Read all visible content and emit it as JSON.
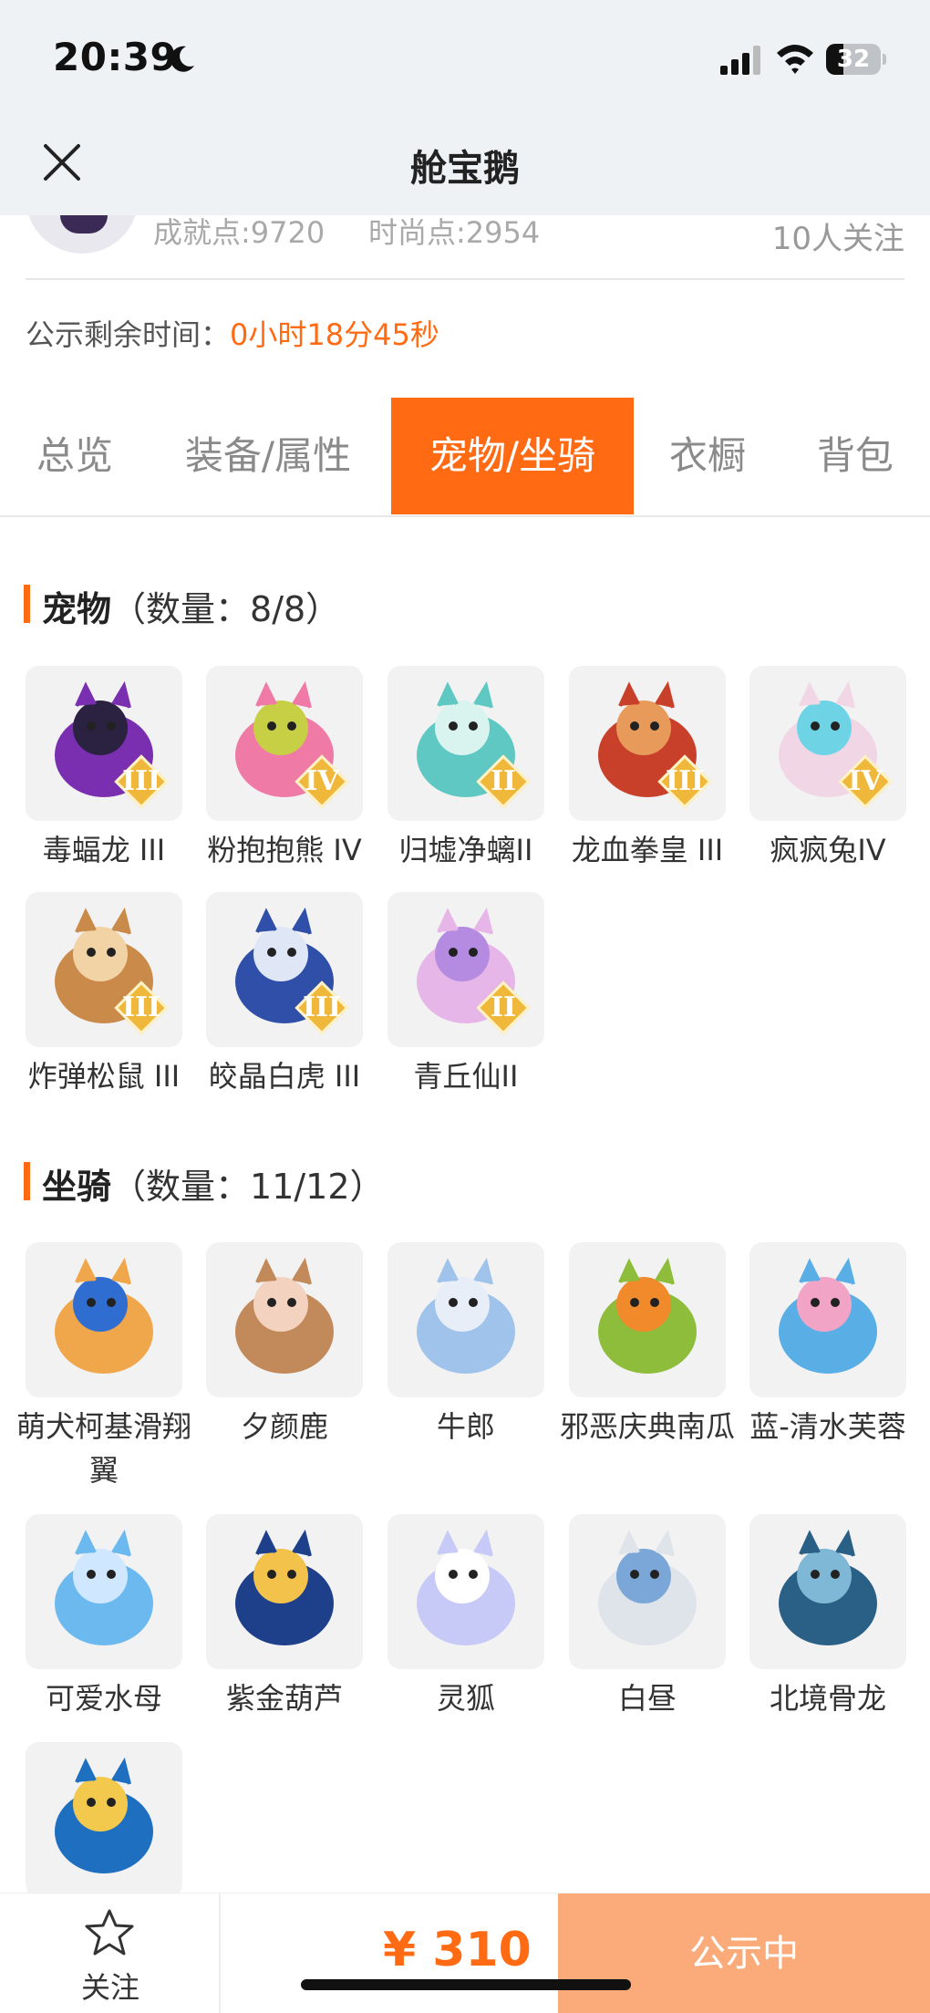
{
  "status_bar": {
    "time": "20:39",
    "battery": "32"
  },
  "header": {
    "title": "舱宝鹅"
  },
  "profile": {
    "achievement_points": "成就点:9720",
    "fashion_points": "时尚点:2954",
    "followers": "10人关注"
  },
  "notice": {
    "label": "公示剩余时间：",
    "value": "0小时18分45秒"
  },
  "tabs": [
    {
      "label": "总览"
    },
    {
      "label": "装备/属性"
    },
    {
      "label": "宠物/坐骑"
    },
    {
      "label": "衣橱"
    },
    {
      "label": "背包"
    }
  ],
  "active_tab": "宠物/坐骑",
  "pets": {
    "title": "宠物",
    "count": "（数量：8/8）",
    "items": [
      {
        "name": "毒蝠龙 III",
        "grade": "III",
        "icon": "dragon-bat-icon"
      },
      {
        "name": "粉抱抱熊 IV",
        "grade": "IV",
        "icon": "pink-bear-icon"
      },
      {
        "name": "归墟净螭II",
        "grade": "II",
        "icon": "water-dragon-icon"
      },
      {
        "name": "龙血拳皇 III",
        "grade": "III",
        "icon": "bull-demon-icon"
      },
      {
        "name": "疯疯兔IV",
        "grade": "IV",
        "icon": "rabbit-icon"
      },
      {
        "name": "炸弹松鼠 III",
        "grade": "III",
        "icon": "squirrel-icon"
      },
      {
        "name": "皎晶白虎 III",
        "grade": "III",
        "icon": "white-tiger-icon"
      },
      {
        "name": "青丘仙II",
        "grade": "II",
        "icon": "fox-fairy-icon"
      }
    ]
  },
  "mounts": {
    "title": "坐骑",
    "count": "（数量：11/12）",
    "items": [
      {
        "name": "萌犬柯基滑翔翼",
        "icon": "corgi-glider-icon"
      },
      {
        "name": "夕颜鹿",
        "icon": "deer-icon"
      },
      {
        "name": "牛郎",
        "icon": "ox-icon"
      },
      {
        "name": "邪恶庆典南瓜",
        "icon": "pumpkin-icon"
      },
      {
        "name": "蓝-清水芙蓉",
        "icon": "lotus-icon"
      },
      {
        "name": "可爱水母",
        "icon": "jellyfish-icon"
      },
      {
        "name": "紫金葫芦",
        "icon": "gourd-icon"
      },
      {
        "name": "灵狐",
        "icon": "spirit-fox-icon"
      },
      {
        "name": "白昼",
        "icon": "white-dragon-icon"
      },
      {
        "name": "北境骨龙",
        "icon": "bone-dragon-icon"
      },
      {
        "name": "",
        "icon": "blue-phoenix-icon"
      }
    ]
  },
  "bottom_bar": {
    "follow_label": "关注",
    "price": "¥ 310",
    "status_label": "公示中"
  },
  "colors": {
    "accent": "#ff6a13",
    "status_button": "#fbab7a"
  }
}
